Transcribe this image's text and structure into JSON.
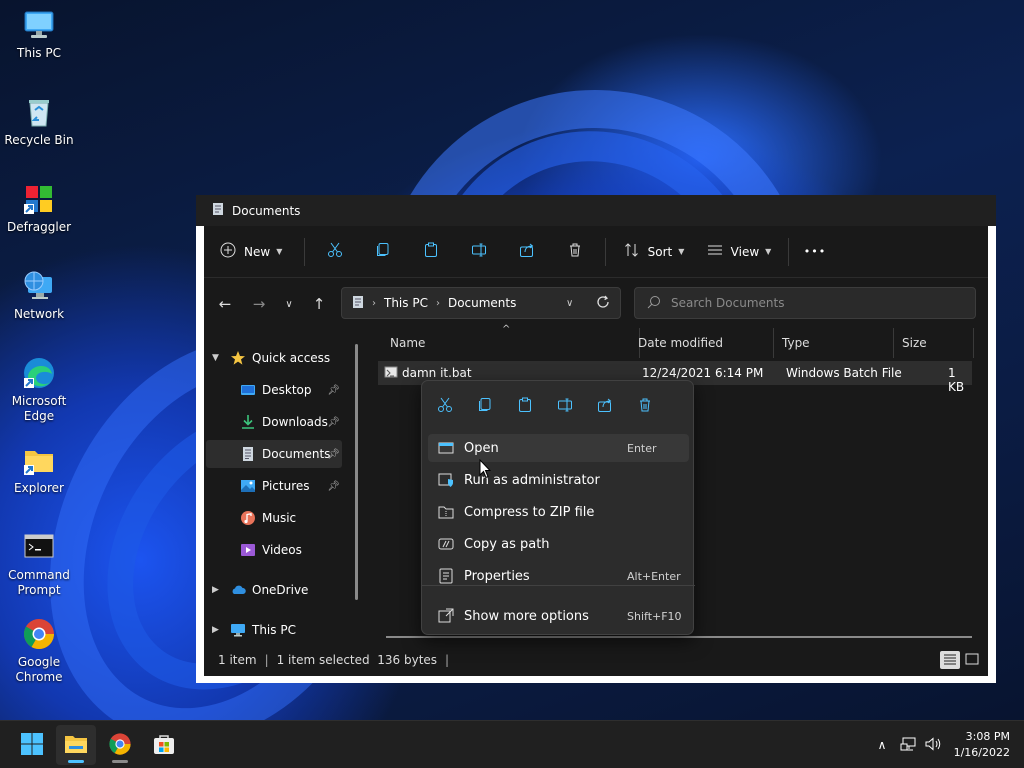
{
  "desktop": {
    "icons": [
      {
        "label": "This PC"
      },
      {
        "label": "Recycle Bin"
      },
      {
        "label": "Defraggler"
      },
      {
        "label": "Network"
      },
      {
        "label": "Microsoft Edge"
      },
      {
        "label": "Explorer"
      },
      {
        "label": "Command Prompt"
      },
      {
        "label": "Google Chrome"
      }
    ]
  },
  "window": {
    "title": "Documents",
    "toolbar": {
      "new_label": "New",
      "sort_label": "Sort",
      "view_label": "View",
      "more_label": "•••"
    },
    "address": {
      "crumbs": [
        "This PC",
        "Documents"
      ]
    },
    "search": {
      "placeholder": "Search Documents"
    },
    "navpane": {
      "quick_access": "Quick access",
      "items": [
        {
          "label": "Desktop",
          "pinned": true
        },
        {
          "label": "Downloads",
          "pinned": true
        },
        {
          "label": "Documents",
          "pinned": true,
          "selected": true
        },
        {
          "label": "Pictures",
          "pinned": true
        },
        {
          "label": "Music",
          "pinned": false
        },
        {
          "label": "Videos",
          "pinned": false
        }
      ],
      "onedrive": "OneDrive",
      "thispc": "This PC"
    },
    "columns": [
      "Name",
      "Date modified",
      "Type",
      "Size"
    ],
    "files": [
      {
        "name": "damn it.bat",
        "date": "12/24/2021 6:14 PM",
        "type": "Windows Batch File",
        "size": "1 KB"
      }
    ],
    "status": {
      "count": "1 item",
      "selected": "1 item selected  136 bytes"
    }
  },
  "context_menu": {
    "items": [
      {
        "label": "Open",
        "shortcut": "Enter"
      },
      {
        "label": "Run as administrator",
        "shortcut": ""
      },
      {
        "label": "Compress to ZIP file",
        "shortcut": ""
      },
      {
        "label": "Copy as path",
        "shortcut": ""
      },
      {
        "label": "Properties",
        "shortcut": "Alt+Enter"
      }
    ],
    "more": {
      "label": "Show more options",
      "shortcut": "Shift+F10"
    }
  },
  "taskbar": {
    "time": "3:08 PM",
    "date": "1/16/2022"
  },
  "colors": {
    "accent": "#4cc2ff",
    "window_bg": "#191919",
    "taskbar_bg": "#202020"
  }
}
